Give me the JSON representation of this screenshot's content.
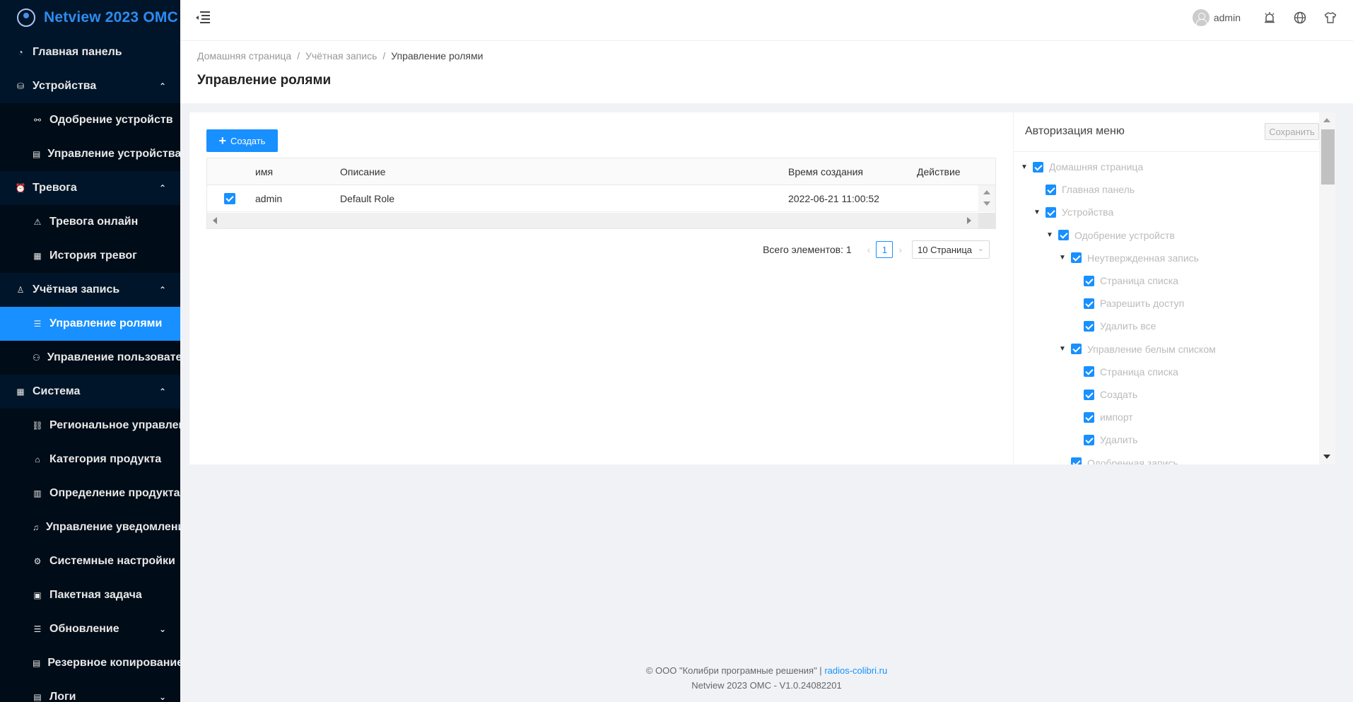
{
  "app": {
    "title": "Netview 2023 OMC"
  },
  "sidebar": {
    "items": [
      {
        "label": "Главная панель",
        "icon": "dashboard-icon",
        "level": "top",
        "chevron": ""
      },
      {
        "label": "Устройства",
        "icon": "devices-icon",
        "level": "top",
        "chevron": "up"
      },
      {
        "label": "Одобрение устройств",
        "icon": "link-icon",
        "level": "sub",
        "chevron": ""
      },
      {
        "label": "Управление устройствами",
        "icon": "list-doc-icon",
        "level": "sub",
        "chevron": ""
      },
      {
        "label": "Тревога",
        "icon": "alarm-icon",
        "level": "top",
        "chevron": "up"
      },
      {
        "label": "Тревога онлайн",
        "icon": "warning-icon",
        "level": "sub",
        "chevron": ""
      },
      {
        "label": "История тревог",
        "icon": "history-icon",
        "level": "sub",
        "chevron": ""
      },
      {
        "label": "Учётная запись",
        "icon": "user-icon",
        "level": "top",
        "chevron": "up"
      },
      {
        "label": "Управление ролями",
        "icon": "menu-lines-icon",
        "level": "sub",
        "chevron": "",
        "active": true
      },
      {
        "label": "Управление пользователями",
        "icon": "users-icon",
        "level": "sub",
        "chevron": ""
      },
      {
        "label": "Система",
        "icon": "system-icon",
        "level": "top",
        "chevron": "up"
      },
      {
        "label": "Региональное управление",
        "icon": "region-icon",
        "level": "sub",
        "chevron": ""
      },
      {
        "label": "Категория продукта",
        "icon": "tag-icon",
        "level": "sub",
        "chevron": ""
      },
      {
        "label": "Определение продукта",
        "icon": "product-icon",
        "level": "sub",
        "chevron": ""
      },
      {
        "label": "Управление уведомлениями",
        "icon": "bell-icon",
        "level": "sub",
        "chevron": ""
      },
      {
        "label": "Системные настройки",
        "icon": "gear-icon",
        "level": "sub",
        "chevron": ""
      },
      {
        "label": "Пакетная задача",
        "icon": "batch-icon",
        "level": "sub",
        "chevron": ""
      },
      {
        "label": "Обновление",
        "icon": "update-icon",
        "level": "sub",
        "chevron": "down"
      },
      {
        "label": "Резервное копирование",
        "icon": "backup-icon",
        "level": "sub",
        "chevron": ""
      },
      {
        "label": "Логи",
        "icon": "logs-icon",
        "level": "sub",
        "chevron": "down"
      }
    ]
  },
  "header": {
    "user": "admin"
  },
  "breadcrumb": [
    "Домашняя страница",
    "Учётная запись",
    "Управление ролями"
  ],
  "page_title": "Управление ролями",
  "toolbar": {
    "create_label": "Создать"
  },
  "table": {
    "columns": [
      "имя",
      "Описание",
      "Время создания",
      "Действие"
    ],
    "rows": [
      {
        "name": "admin",
        "description": "Default Role",
        "created": "2022-06-21 11:00:52",
        "checked": true
      }
    ]
  },
  "pagination": {
    "total_label": "Всего элементов: 1",
    "current_page": "1",
    "page_size": "10 Страница"
  },
  "auth_panel": {
    "title": "Авторизация меню",
    "save_label": "Сохранить",
    "tree": [
      {
        "label": "Домашняя страница",
        "depth": 0,
        "expandable": true
      },
      {
        "label": "Главная панель",
        "depth": 1,
        "expandable": false
      },
      {
        "label": "Устройства",
        "depth": 1,
        "expandable": true
      },
      {
        "label": "Одобрение устройств",
        "depth": 2,
        "expandable": true
      },
      {
        "label": "Неутвержденная запись",
        "depth": 3,
        "expandable": true
      },
      {
        "label": "Страница списка",
        "depth": 4,
        "expandable": false
      },
      {
        "label": "Разрешить доступ",
        "depth": 4,
        "expandable": false
      },
      {
        "label": "Удалить все",
        "depth": 4,
        "expandable": false
      },
      {
        "label": "Управление белым списком",
        "depth": 3,
        "expandable": true
      },
      {
        "label": "Страница списка",
        "depth": 4,
        "expandable": false
      },
      {
        "label": "Создать",
        "depth": 4,
        "expandable": false
      },
      {
        "label": "импорт",
        "depth": 4,
        "expandable": false
      },
      {
        "label": "Удалить",
        "depth": 4,
        "expandable": false
      },
      {
        "label": "Одобренная запись",
        "depth": 3,
        "expandable": false
      }
    ]
  },
  "footer": {
    "copyright": "© ООО \"Колибри програмные решения\" |",
    "link": "radios-colibri.ru",
    "version": "Netview 2023 OMC - V1.0.24082201"
  },
  "colors": {
    "accent": "#1890ff",
    "sidebar_bg": "#001529",
    "sidebar_sub_bg": "#000c17"
  }
}
